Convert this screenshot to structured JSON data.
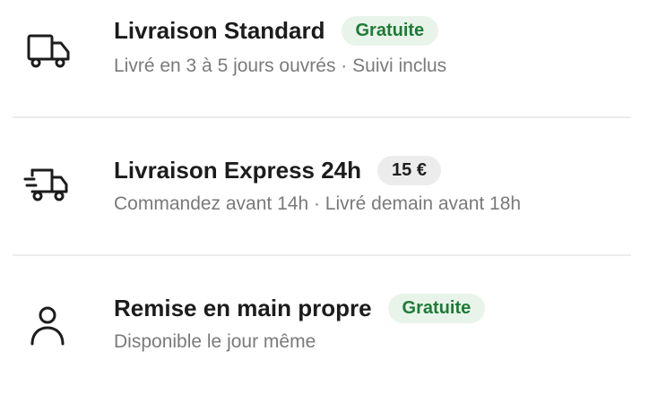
{
  "options": [
    {
      "icon": "truck-icon",
      "title": "Livraison Standard",
      "badge": "Gratuite",
      "badge_type": "free",
      "subtitle": "Livré en 3 à 5 jours ouvrés · Suivi inclus"
    },
    {
      "icon": "express-truck-icon",
      "title": "Livraison Express 24h",
      "badge": "15 €",
      "badge_type": "price",
      "subtitle": "Commandez avant 14h · Livré demain avant 18h"
    },
    {
      "icon": "person-icon",
      "title": "Remise en main propre",
      "badge": "Gratuite",
      "badge_type": "free",
      "subtitle": "Disponible le jour même"
    }
  ],
  "colors": {
    "free_badge_bg": "#e8f4ea",
    "free_badge_text": "#1f7a36",
    "price_badge_bg": "#ececec",
    "subtitle": "#7a7a7a"
  }
}
